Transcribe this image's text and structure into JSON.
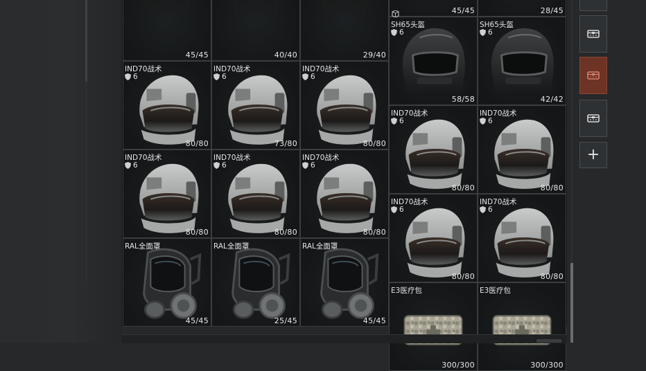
{
  "stash_left": {
    "top_row": [
      {
        "durability": "45/45",
        "kind": "old-helmet"
      },
      {
        "durability": "40/40",
        "kind": "old-helmet"
      },
      {
        "durability": "29/40",
        "kind": "old-helmet"
      }
    ],
    "rows": [
      [
        {
          "name": "IND70战术",
          "level": "6",
          "durability": "80/80",
          "kind": "tactical"
        },
        {
          "name": "IND70战术",
          "level": "6",
          "durability": "73/80",
          "kind": "tactical"
        },
        {
          "name": "IND70战术",
          "level": "6",
          "durability": "80/80",
          "kind": "tactical"
        }
      ],
      [
        {
          "name": "IND70战术",
          "level": "6",
          "durability": "80/80",
          "kind": "tactical"
        },
        {
          "name": "IND70战术",
          "level": "6",
          "durability": "80/80",
          "kind": "tactical"
        },
        {
          "name": "IND70战术",
          "level": "6",
          "durability": "80/80",
          "kind": "tactical"
        }
      ],
      [
        {
          "name": "RAL全面罩",
          "durability": "45/45",
          "kind": "gasmask"
        },
        {
          "name": "RAL全面罩",
          "durability": "25/45",
          "kind": "gasmask"
        },
        {
          "name": "RAL全面罩",
          "durability": "45/45",
          "kind": "gasmask"
        }
      ]
    ]
  },
  "stash_right": {
    "top_row": [
      {
        "durability": "45/45"
      },
      {
        "durability": "28/45"
      }
    ],
    "rows": [
      [
        {
          "name": "SH65头盔",
          "level": "6",
          "durability": "58/58",
          "kind": "sh65"
        },
        {
          "name": "SH65头盔",
          "level": "6",
          "durability": "42/42",
          "kind": "sh65"
        }
      ],
      [
        {
          "name": "IND70战术",
          "level": "6",
          "durability": "80/80",
          "kind": "tactical"
        },
        {
          "name": "IND70战术",
          "level": "6",
          "durability": "80/80",
          "kind": "tactical"
        }
      ],
      [
        {
          "name": "IND70战术",
          "level": "6",
          "durability": "80/80",
          "kind": "tactical"
        },
        {
          "name": "IND70战术",
          "level": "6",
          "durability": "80/80",
          "kind": "tactical"
        }
      ],
      [
        {
          "name": "E3医疗包",
          "durability": "300/300",
          "kind": "medkit"
        },
        {
          "name": "E3医疗包",
          "durability": "300/300",
          "kind": "medkit"
        }
      ]
    ]
  },
  "side_tabs": [
    {
      "icon": "box-icon",
      "active": false
    },
    {
      "icon": "box-icon",
      "active": true
    },
    {
      "icon": "box-icon",
      "active": false
    },
    {
      "icon": "plus-icon",
      "active": false,
      "label": "+"
    }
  ],
  "colors": {
    "accent": "#6d3325",
    "cell_border": "#3b3e40",
    "background": "#262829"
  }
}
